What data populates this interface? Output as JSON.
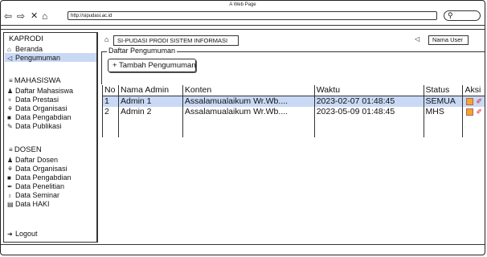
{
  "window": {
    "title": "A Web Page",
    "url": "http://sipudasi.ac.id"
  },
  "header": {
    "breadcrumb": "SI-PUDASI PRODI SISTEM INFORMASI",
    "user_placeholder": "Nama User"
  },
  "sidebar": {
    "role_heading": "KAPRODI",
    "top_items": [
      {
        "label": "Beranda",
        "icon": "home-icon"
      },
      {
        "label": "Pengumuman",
        "icon": "megaphone-icon"
      }
    ],
    "mahasiswa_heading": "MAHASISWA",
    "mahasiswa_items": [
      {
        "label": "Daftar Mahasiswa",
        "icon": "users-icon"
      },
      {
        "label": "Data Prestasi",
        "icon": "trophy-icon"
      },
      {
        "label": "Data Organisasi",
        "icon": "sitemap-icon"
      },
      {
        "label": "Data Pengabdian",
        "icon": "briefcase-icon"
      },
      {
        "label": "Data Publikasi",
        "icon": "pencil-icon"
      }
    ],
    "dosen_heading": "DOSEN",
    "dosen_items": [
      {
        "label": "Daftar Dosen",
        "icon": "users-icon"
      },
      {
        "label": "Data Organisasi",
        "icon": "sitemap-icon"
      },
      {
        "label": "Data Pengabdian",
        "icon": "briefcase-icon"
      },
      {
        "label": "Data Penelitian",
        "icon": "pen-icon"
      },
      {
        "label": "Data Seminar",
        "icon": "lightbulb-icon"
      },
      {
        "label": "Data HAKI",
        "icon": "book-icon"
      }
    ],
    "logout": "Logout"
  },
  "main": {
    "section_title": "Daftar Pengumuman",
    "add_button": "+ Tambah Pengumuman",
    "table": {
      "headers": [
        "No",
        "Nama Admin",
        "Konten",
        "Waktu",
        "Status",
        "Aksi"
      ],
      "rows": [
        [
          "1",
          "Admin 1",
          "Assalamualaikum Wr.Wb....",
          "2023-02-07 01:48:45",
          "SEMUA"
        ],
        [
          "2",
          "Admin 2",
          "Assalamualaikum Wr.Wb....",
          "2023-05-09 01:48:45",
          "MHS"
        ]
      ]
    }
  },
  "colors": {
    "selection": "#c9d9f5",
    "edit_icon": "#f5a623",
    "delete_icon": "#dd1111"
  }
}
